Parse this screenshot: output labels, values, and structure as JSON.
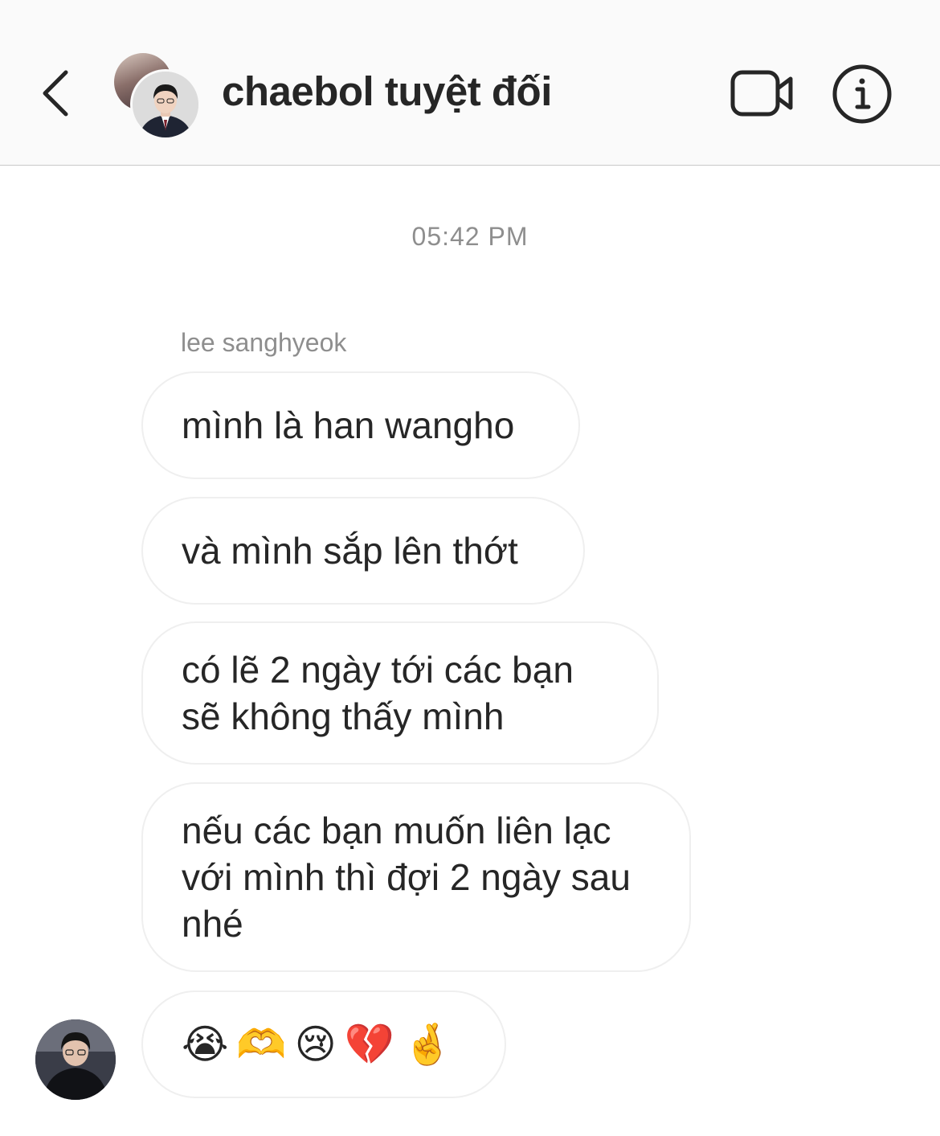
{
  "header": {
    "title": "chaebol tuyệt đối",
    "back_icon": "chevron-left-icon",
    "video_icon": "video-camera-icon",
    "info_icon": "info-icon"
  },
  "conversation": {
    "timestamp": "05:42 PM",
    "sender_name": "lee sanghyeok",
    "messages": [
      "mình là han wangho",
      "và mình sắp lên thớt",
      "có lẽ 2 ngày tới các bạn sẽ không thấy mình",
      "nếu các bạn muốn liên lạc với mình thì đợi 2 ngày sau nhé",
      "😭🫶😢💔🤞"
    ]
  },
  "colors": {
    "header_bg": "#fafafa",
    "text": "#262626",
    "muted": "#8e8e8e",
    "bubble_border": "#efefef"
  }
}
